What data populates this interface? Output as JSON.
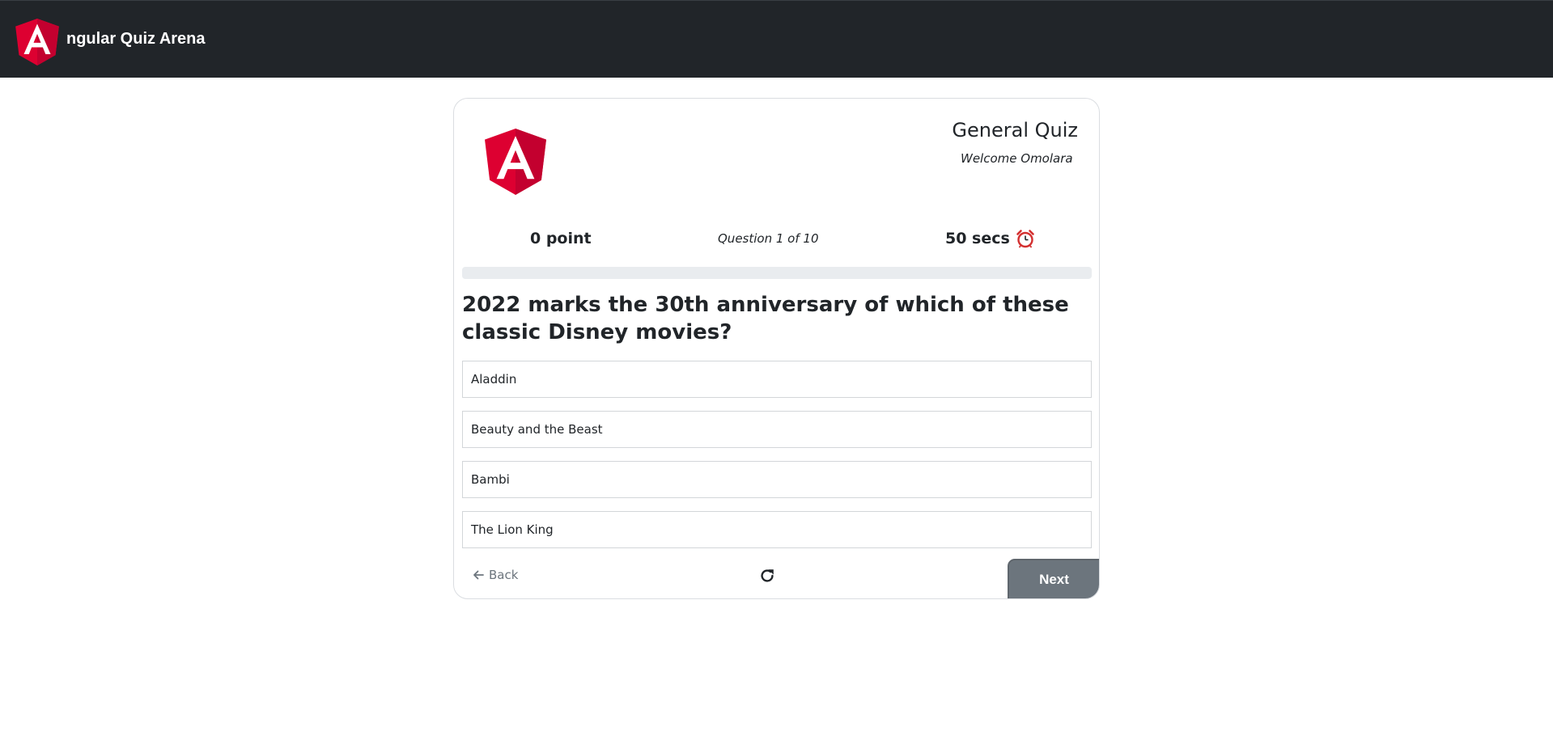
{
  "navbar": {
    "title": "ngular Quiz Arena",
    "logo_icon": "angular-logo-icon"
  },
  "quiz": {
    "title": "General Quiz",
    "welcome": "Welcome Omolara",
    "logo_icon": "angular-logo-icon",
    "points": "0 point",
    "counter": "Question 1 of 10",
    "timer": "50 secs",
    "timer_icon": "alarm-clock-icon",
    "progress": 0,
    "question": "2022 marks the 30th anniversary of which of these classic Disney movies?",
    "options": [
      {
        "label": "Aladdin"
      },
      {
        "label": "Beauty and the Beast"
      },
      {
        "label": "Bambi"
      },
      {
        "label": "The Lion King"
      }
    ]
  },
  "controls": {
    "back_label": "Back",
    "back_icon": "arrow-left-icon",
    "reset_icon": "refresh-icon",
    "next_label": "Next"
  },
  "colors": {
    "navbar_bg": "#212529",
    "angular_red": "#dd0031",
    "next_bg": "#6c757d",
    "progress_track": "#e9ecef"
  }
}
